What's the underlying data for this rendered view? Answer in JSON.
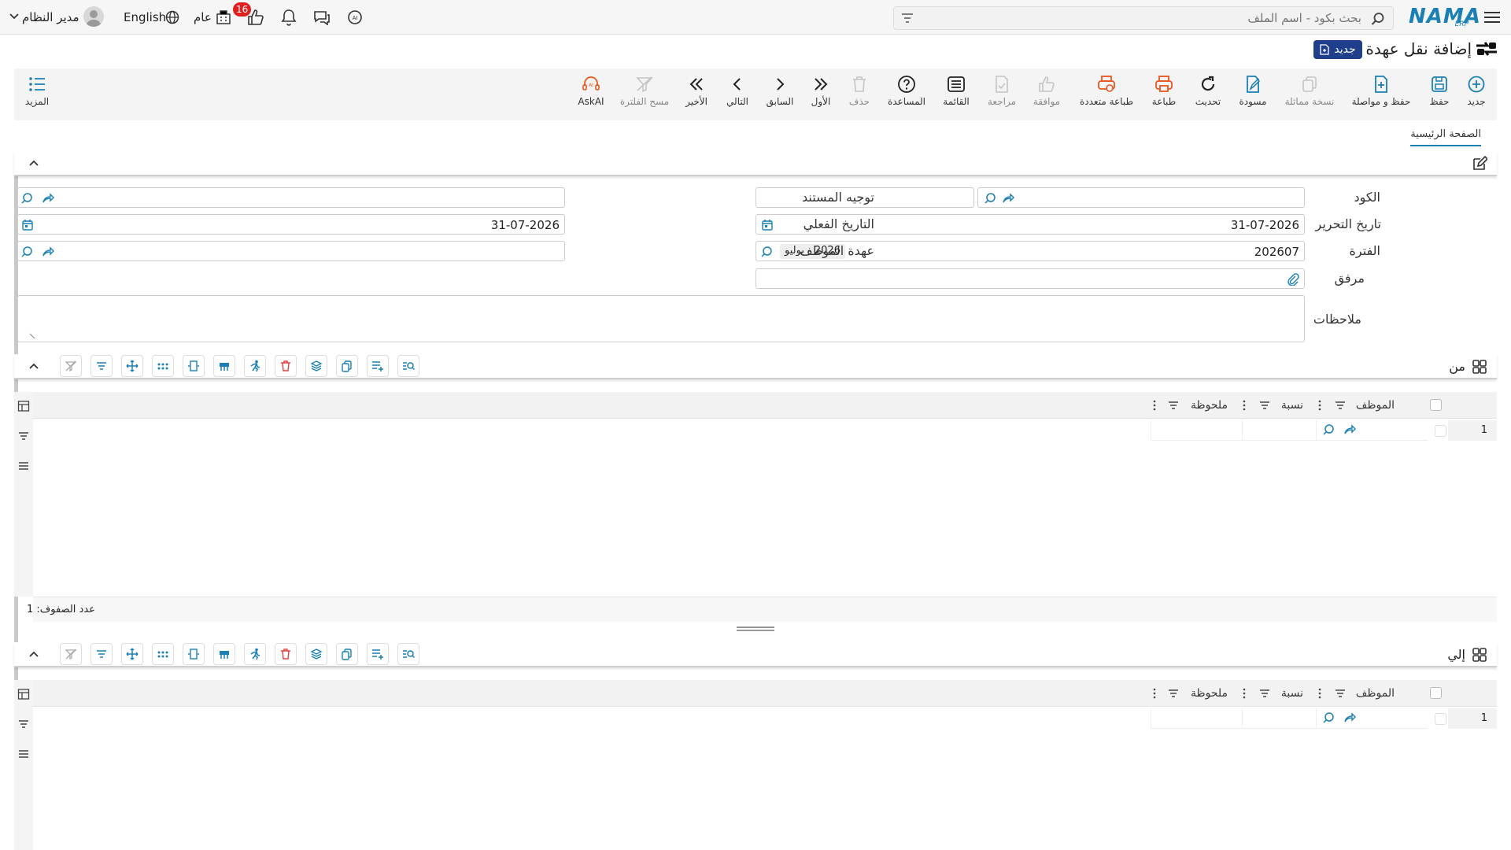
{
  "topbar": {
    "search_placeholder": "بحث بكود - اسم الملف",
    "logo_text": "NAMA",
    "logo_sub": "ERP",
    "notifications_count": "16",
    "scope_label": "عام",
    "language_label": "English",
    "user_label": "مدير النظام"
  },
  "page": {
    "title": "إضافة نقل عهدة",
    "status_badge": "جديد"
  },
  "toolbar": {
    "items": [
      {
        "label": "جديد",
        "icon": "plus-circle-icon"
      },
      {
        "label": "حفظ",
        "icon": "save-icon"
      },
      {
        "label": "حفظ و مواصلة",
        "icon": "save-continue-icon"
      },
      {
        "label": "نسخة مماثلة",
        "icon": "copy-icon"
      },
      {
        "label": "مسودة",
        "icon": "draft-icon"
      },
      {
        "label": "تحديث",
        "icon": "refresh-icon"
      },
      {
        "label": "طباعة",
        "icon": "print-icon"
      },
      {
        "label": "طباعة متعددة",
        "icon": "multi-print-icon"
      },
      {
        "label": "موافقة",
        "icon": "approve-icon"
      },
      {
        "label": "مراجعة",
        "icon": "review-icon"
      },
      {
        "label": "القائمة",
        "icon": "list-icon"
      },
      {
        "label": "المساعدة",
        "icon": "help-icon"
      },
      {
        "label": "حذف",
        "icon": "trash-icon"
      },
      {
        "label": "الأول",
        "icon": "first-icon"
      },
      {
        "label": "السابق",
        "icon": "previous-icon"
      },
      {
        "label": "التالي",
        "icon": "next-icon"
      },
      {
        "label": "الأخير",
        "icon": "last-icon"
      },
      {
        "label": "مسح الفلترة",
        "icon": "clear-filter-icon"
      },
      {
        "label": "AskAI",
        "icon": "ask-ai-icon"
      }
    ],
    "more_label": "المزيد"
  },
  "tabs": {
    "main": "الصفحة الرئيسية"
  },
  "form": {
    "code_label": "الكود",
    "code_value": "",
    "doc_direction_label": "توجيه المستند",
    "doc_direction_value": "",
    "edit_date_label": "تاريخ التحرير",
    "edit_date_value": "31-07-2026",
    "actual_date_label": "التاريخ الفعلي",
    "actual_date_value": "31-07-2026",
    "period_label": "الفترة",
    "period_value": "202607",
    "period_chip": "2026 - يوليو",
    "employee_custody_label": "عهدة الموظف",
    "employee_custody_value": "",
    "attachment_label": "مرفق",
    "notes_label": "ملاحظات",
    "notes_value": ""
  },
  "from_grid": {
    "title": "من",
    "columns": [
      "الموظف",
      "نسبة",
      "ملحوظة"
    ],
    "rows": [
      {
        "num": "1",
        "employee": "",
        "ratio": "",
        "note": ""
      }
    ],
    "row_count_label": "عدد الصفوف: 1"
  },
  "to_grid": {
    "title": "إلي",
    "columns": [
      "الموظف",
      "نسبة",
      "ملحوظة"
    ],
    "rows": [
      {
        "num": "1",
        "employee": "",
        "ratio": "",
        "note": ""
      }
    ]
  },
  "colors": {
    "accent": "#1a7fb5",
    "badge": "#1f3f8c",
    "print": "#e8561f",
    "danger": "#e04040"
  }
}
